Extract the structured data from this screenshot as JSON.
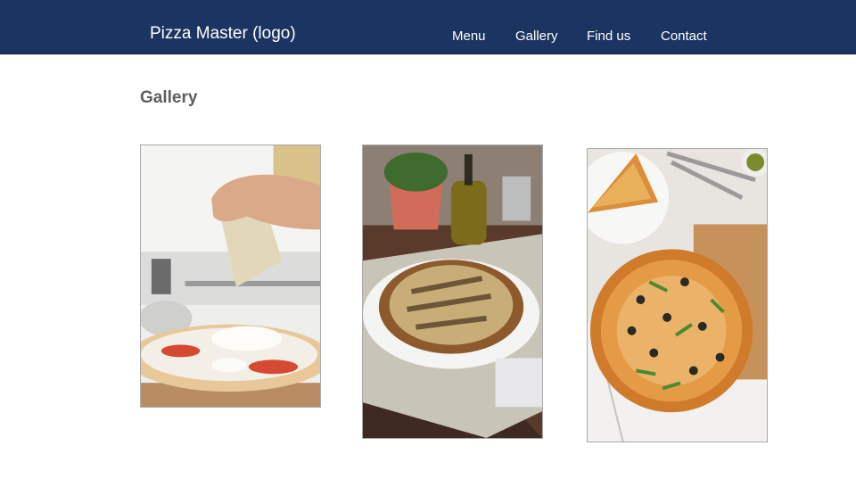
{
  "header": {
    "logo": "Pizza Master (logo)",
    "nav": [
      "Menu",
      "Gallery",
      "Find us",
      "Contact"
    ]
  },
  "main": {
    "title": "Gallery",
    "photos": [
      "grating-cheese-on-pizza-photo",
      "pizza-with-plant-and-olive-oil-photo",
      "olive-arugula-pizza-photo"
    ]
  },
  "colors": {
    "navbar": "#1c3461",
    "title": "#5e5e5e",
    "border": "#a9a9a9"
  }
}
